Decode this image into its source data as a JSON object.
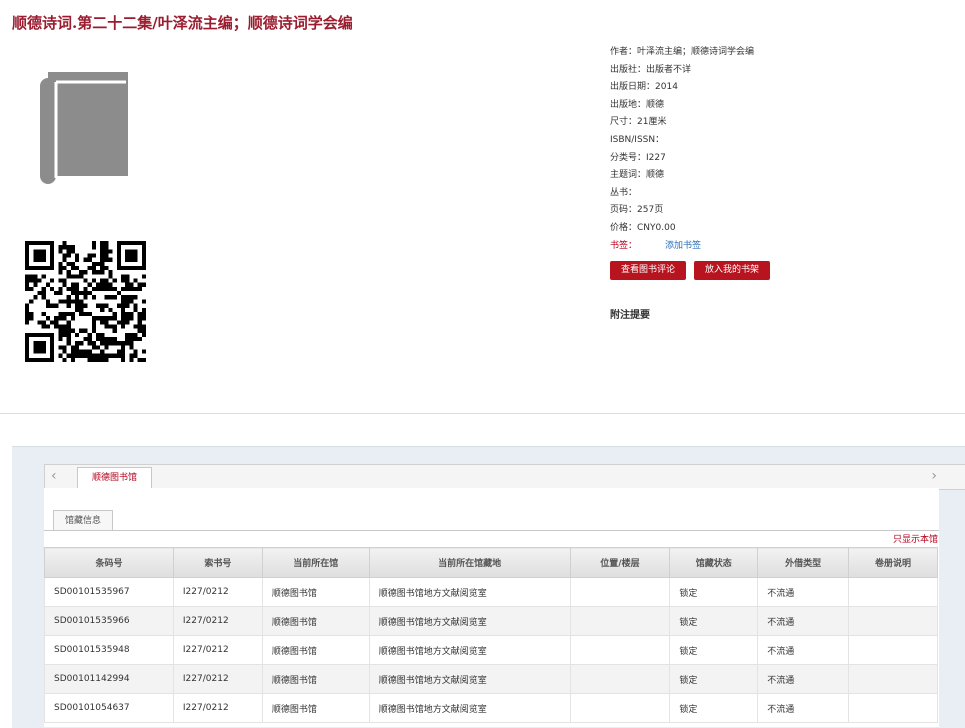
{
  "page": {
    "title": "顺德诗词.第二十二集/叶泽流主编；顺德诗词学会编"
  },
  "icons": {
    "cover": "book-icon",
    "qr": "qr-code-icon"
  },
  "details": [
    {
      "label": "作者：",
      "value": "叶泽流主编；顺德诗词学会编"
    },
    {
      "label": "出版社：",
      "value": "出版者不详"
    },
    {
      "label": "出版日期：",
      "value": "2014"
    },
    {
      "label": "出版地：",
      "value": "顺德"
    },
    {
      "label": "尺寸：",
      "value": "21厘米"
    },
    {
      "label": "ISBN/ISSN：",
      "value": ""
    },
    {
      "label": "分类号：",
      "value": "I227"
    },
    {
      "label": "主题词：",
      "value": "顺德"
    },
    {
      "label": "丛书：",
      "value": ""
    },
    {
      "label": "页码：",
      "value": "257页"
    },
    {
      "label": "价格：",
      "value": "CNY0.00"
    }
  ],
  "bookmark": {
    "label": "书签：",
    "link": "添加书签"
  },
  "actions": {
    "review": "查看图书评论",
    "shelf": "放入我的书架"
  },
  "annotation": "附注提要",
  "library_tab": "顺德图书馆",
  "holdings_tab": "馆藏信息",
  "only_this_library": "只显示本馆",
  "table": {
    "headers": [
      "条码号",
      "索书号",
      "当前所在馆",
      "当前所在馆藏地",
      "位置/楼层",
      "馆藏状态",
      "外借类型",
      "卷册说明"
    ],
    "rows": [
      [
        "SD00101535967",
        "I227/0212",
        "顺德图书馆",
        "顺德图书馆地方文献阅览室",
        "",
        "锁定",
        "不流通",
        ""
      ],
      [
        "SD00101535966",
        "I227/0212",
        "顺德图书馆",
        "顺德图书馆地方文献阅览室",
        "",
        "锁定",
        "不流通",
        ""
      ],
      [
        "SD00101535948",
        "I227/0212",
        "顺德图书馆",
        "顺德图书馆地方文献阅览室",
        "",
        "锁定",
        "不流通",
        ""
      ],
      [
        "SD00101142994",
        "I227/0212",
        "顺德图书馆",
        "顺德图书馆地方文献阅览室",
        "",
        "锁定",
        "不流通",
        ""
      ],
      [
        "SD00101054637",
        "I227/0212",
        "顺德图书馆",
        "顺德图书馆地方文献阅览室",
        "",
        "锁定",
        "不流通",
        ""
      ]
    ]
  }
}
